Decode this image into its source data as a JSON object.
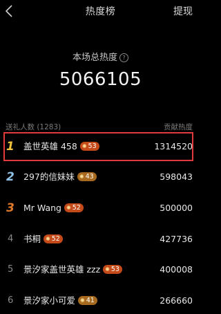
{
  "header": {
    "title": "热度榜",
    "withdraw_label": "提现"
  },
  "summary": {
    "total_label": "本场总热度",
    "help_glyph": "?",
    "total_value": "5066105"
  },
  "columns": {
    "left_label": "送礼人数 (1283)",
    "right_label": "贡献热度"
  },
  "rows": [
    {
      "rank": "1",
      "name": "盖世英雄 458",
      "level": "53",
      "heat": "1314520",
      "rank_color": "#f2c23a",
      "badge_color": "#c44a1a"
    },
    {
      "rank": "2",
      "name": "297的信妹妹",
      "level": "43",
      "heat": "598043",
      "rank_color": "#8fc3e8",
      "badge_color": "#a86a1e"
    },
    {
      "rank": "3",
      "name": "Mr Wang",
      "level": "52",
      "heat": "500000",
      "rank_color": "#e07a2a",
      "badge_color": "#c44a1a"
    },
    {
      "rank": "4",
      "name": "书桐",
      "level": "52",
      "heat": "427736",
      "rank_color": "#8a8a8a",
      "badge_color": "#c44a1a"
    },
    {
      "rank": "5",
      "name": "景汐家盖世英雄 zzz",
      "level": "53",
      "heat": "400008",
      "rank_color": "#8a8a8a",
      "badge_color": "#c44a1a"
    },
    {
      "rank": "6",
      "name": "景汐家小可爱",
      "level": "41",
      "heat": "266660",
      "rank_color": "#8a8a8a",
      "badge_color": "#a86a1e"
    }
  ],
  "icons": {
    "back": "chevron-left-icon",
    "help": "question-circle-icon",
    "badge": "sun-badge-icon"
  },
  "colors": {
    "background": "#000000",
    "highlight_border": "#e43a3a"
  }
}
